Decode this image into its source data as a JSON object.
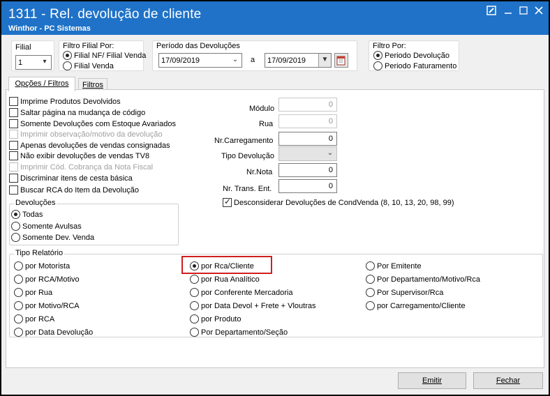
{
  "window": {
    "title": "1311 - Rel. devolução de cliente",
    "subtitle": "Winthor - PC Sistemas"
  },
  "filial": {
    "label": "Filial",
    "value": "1"
  },
  "filtro_filial": {
    "title": "Filtro Filial Por:",
    "options": [
      {
        "label": "Filial NF/ Filial Venda",
        "selected": true
      },
      {
        "label": "Filial Venda",
        "selected": false
      }
    ]
  },
  "periodo": {
    "title": "Período das Devoluções",
    "start": "17/09/2019",
    "separator": "a",
    "end": "17/09/2019"
  },
  "filtro_por": {
    "title": "Filtro Por:",
    "options": [
      {
        "label": "Periodo Devolução",
        "selected": true
      },
      {
        "label": "Periodo Faturamento",
        "selected": false
      }
    ]
  },
  "tabs": [
    {
      "label": "Opções / Filtros",
      "active": true
    },
    {
      "label": "Filtros",
      "active": false
    }
  ],
  "checkboxes": [
    {
      "label": "Imprime Produtos Devolvidos",
      "checked": false,
      "disabled": false
    },
    {
      "label": "Saltar página na mudança de código",
      "checked": false,
      "disabled": false
    },
    {
      "label": "Somente Devoluções com Estoque Avariados",
      "checked": false,
      "disabled": false
    },
    {
      "label": "Imprimir observação/motivo da devolução",
      "checked": false,
      "disabled": true
    },
    {
      "label": "Apenas devoluções de vendas consignadas",
      "checked": false,
      "disabled": false
    },
    {
      "label": "Não exibir devoluções de vendas TV8",
      "checked": false,
      "disabled": false
    },
    {
      "label": "Imprimir Cód. Cobrança da Nota Fiscal",
      "checked": false,
      "disabled": true
    },
    {
      "label": "Discriminar itens de cesta básica",
      "checked": false,
      "disabled": false
    },
    {
      "label": "Buscar RCA do Item da Devolução",
      "checked": false,
      "disabled": false
    }
  ],
  "fields": {
    "modulo": {
      "label": "Módulo",
      "value": "0"
    },
    "rua": {
      "label": "Rua",
      "value": "0"
    },
    "carregamento": {
      "label": "Nr.Carregamento",
      "value": "0"
    },
    "tipo_devolucao": {
      "label": "Tipo Devolução",
      "value": ""
    },
    "nr_nota": {
      "label": "Nr.Nota",
      "value": "0"
    },
    "nr_trans": {
      "label": "Nr. Trans. Ent.",
      "value": "0"
    }
  },
  "desconsiderar": {
    "label": "Desconsiderar  Devoluções de CondVenda (8, 10, 13, 20, 98, 99)",
    "checked": true
  },
  "devolucoes": {
    "title": "Devoluções",
    "options": [
      {
        "label": "Todas",
        "selected": true
      },
      {
        "label": "Somente Avulsas",
        "selected": false
      },
      {
        "label": "Somente Dev. Venda",
        "selected": false
      }
    ]
  },
  "tipo_relatorio": {
    "title": "Tipo Relatório",
    "col1": [
      {
        "label": "por Motorista",
        "selected": false
      },
      {
        "label": "por RCA/Motivo",
        "selected": false
      },
      {
        "label": "por Rua",
        "selected": false
      },
      {
        "label": "por Motivo/RCA",
        "selected": false
      },
      {
        "label": "por RCA",
        "selected": false
      },
      {
        "label": "por Data Devolução",
        "selected": false
      }
    ],
    "col2": [
      {
        "label": "por Rca/Cliente",
        "selected": true
      },
      {
        "label": "por Rua Analítico",
        "selected": false
      },
      {
        "label": "por Conferente Mercadoria",
        "selected": false
      },
      {
        "label": "por Data Devol + Frete + Vloutras",
        "selected": false
      },
      {
        "label": "por Produto",
        "selected": false
      },
      {
        "label": "Por Departamento/Seção",
        "selected": false
      }
    ],
    "col3": [
      {
        "label": "Por Emitente",
        "selected": false
      },
      {
        "label": "Por Departamento/Motivo/Rca",
        "selected": false
      },
      {
        "label": "Por Supervisor/Rca",
        "selected": false
      },
      {
        "label": "por Carregamento/Cliente",
        "selected": false
      }
    ]
  },
  "buttons": {
    "emitir": "Emitir",
    "fechar": "Fechar"
  },
  "colors": {
    "titlebar": "#1f72c8",
    "highlight": "#d01f1f"
  }
}
